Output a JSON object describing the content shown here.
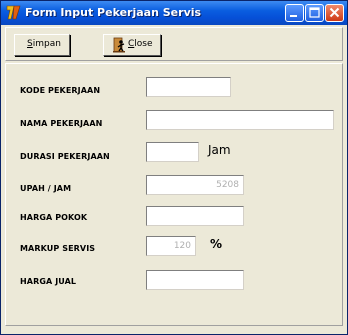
{
  "window": {
    "title": "Form Input Pekerjaan Servis"
  },
  "toolbar": {
    "save_label_accel": "S",
    "save_label_rest": "impan",
    "close_label_accel": "C",
    "close_label_rest": "lose"
  },
  "form": {
    "kode_label": "KODE PEKERJAAN",
    "kode_value": "",
    "nama_label": "NAMA PEKERJAAN",
    "nama_value": "",
    "durasi_label": "DURASI PEKERJAAN",
    "durasi_value": "",
    "durasi_unit": "Jam",
    "upah_label": "UPAH / JAM",
    "upah_value": "5208",
    "harga_pokok_label": "HARGA POKOK",
    "harga_pokok_value": "",
    "markup_label": "MARKUP SERVIS",
    "markup_value": "120",
    "markup_unit": "%",
    "harga_jual_label": "HARGA JUAL",
    "harga_jual_value": ""
  },
  "colors": {
    "title_bar": "#0a5ee0",
    "window_face": "#ece9d8",
    "close_button": "#cf3a16"
  },
  "icons": [
    "delphi-app-icon",
    "minimize-icon",
    "maximize-icon",
    "close-icon",
    "door-exit-icon"
  ]
}
